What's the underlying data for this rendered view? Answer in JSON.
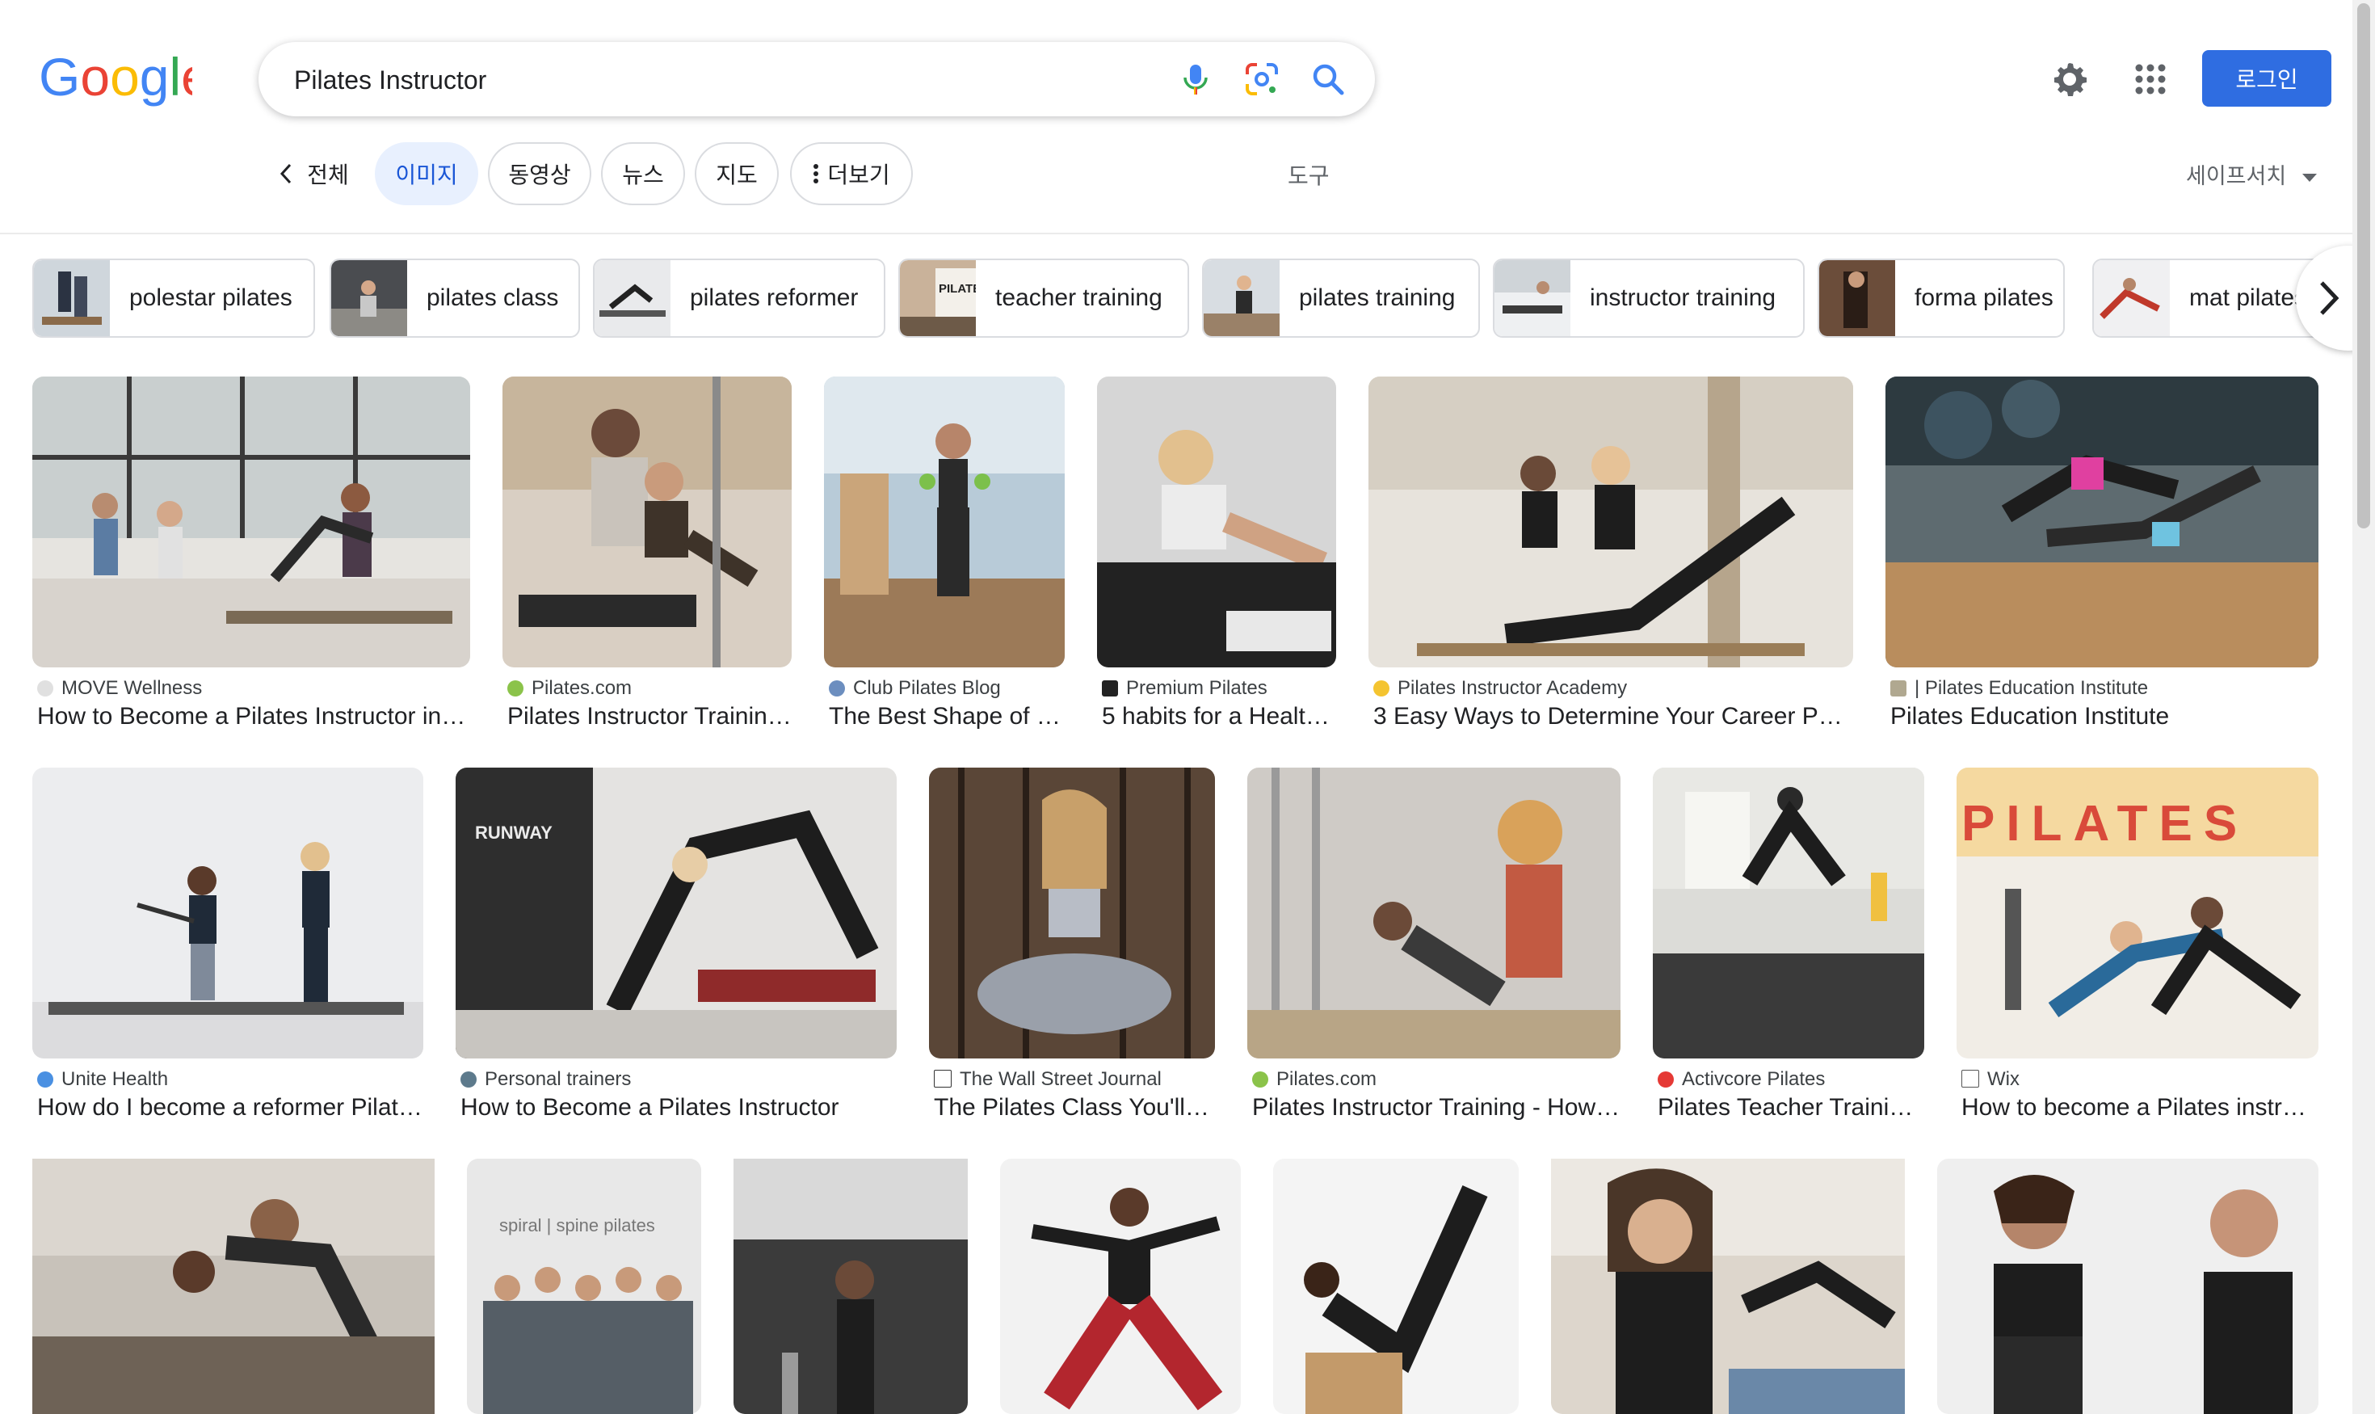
{
  "header": {
    "logo_text": "Google",
    "search_value": "Pilates Instructor",
    "login_label": "로그인"
  },
  "tabs": [
    {
      "label": "전체"
    },
    {
      "label": "이미지"
    },
    {
      "label": "동영상"
    },
    {
      "label": "뉴스"
    },
    {
      "label": "지도"
    },
    {
      "label": "더보기"
    }
  ],
  "tools_label": "도구",
  "safesearch_label": "세이프서치",
  "chips": [
    {
      "label": "polestar pilates"
    },
    {
      "label": "pilates class"
    },
    {
      "label": "pilates reformer"
    },
    {
      "label": "teacher training"
    },
    {
      "label": "pilates training"
    },
    {
      "label": "instructor training"
    },
    {
      "label": "forma pilates"
    },
    {
      "label": "mat pilates"
    }
  ],
  "results": [
    {
      "source": "MOVE Wellness",
      "title": "How to Become a Pilates Instructor in 2…"
    },
    {
      "source": "Pilates.com",
      "title": "Pilates Instructor Trainin…"
    },
    {
      "source": "Club Pilates Blog",
      "title": "The Best Shape of …"
    },
    {
      "source": "Premium Pilates",
      "title": "5 habits for a Health…"
    },
    {
      "source": "Pilates Instructor Academy",
      "title": "3 Easy Ways to Determine Your Career Path …"
    },
    {
      "source": "| Pilates Education Institute",
      "title": "Pilates Education Institute"
    },
    {
      "source": "Unite Health",
      "title": "How do I become a reformer Pilate…"
    },
    {
      "source": "Personal trainers",
      "title": "How to Become a Pilates Instructor"
    },
    {
      "source": "The Wall Street Journal",
      "title": "The Pilates Class You'll …"
    },
    {
      "source": "Pilates.com",
      "title": "Pilates Instructor Training - How t…"
    },
    {
      "source": "Activcore Pilates",
      "title": "Pilates Teacher Trainin…"
    },
    {
      "source": "Wix",
      "title": "How to become a Pilates instru…"
    }
  ],
  "image_overlays": {
    "runway_sign": "RUNWAY",
    "pilates_banner": "PILATES",
    "spiral_spine_sign": "spiral | spine pilates",
    "teacher_chip_sign": "PILATES TEACHER TRAINING"
  },
  "colors": {
    "accent": "#1a73e8",
    "login_bg": "#2f6de1",
    "active_tab_bg": "#e8f0fe"
  }
}
